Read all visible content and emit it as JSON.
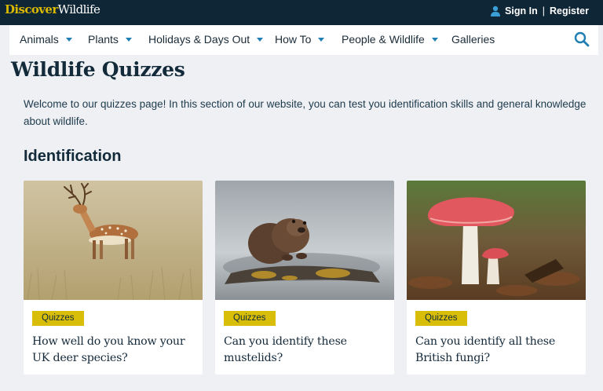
{
  "header": {
    "logo_part1": "Discover",
    "logo_part2": "Wildlife",
    "sign_in": "Sign In",
    "separator": "|",
    "register": "Register"
  },
  "nav": {
    "items": [
      {
        "label": "Animals",
        "has_dropdown": true
      },
      {
        "label": "Plants",
        "has_dropdown": true
      },
      {
        "label": "Holidays & Days Out",
        "has_dropdown": true
      },
      {
        "label": "How To",
        "has_dropdown": true
      },
      {
        "label": "People & Wildlife",
        "has_dropdown": true
      },
      {
        "label": "Galleries",
        "has_dropdown": false
      }
    ],
    "search_icon": "search-icon"
  },
  "main": {
    "title": "Wildlife Quizzes",
    "intro": "Welcome to our quizzes page! In this section of our website, you can test you identification skills and general knowledge about wildlife.",
    "section_heading": "Identification",
    "cards": [
      {
        "badge": "Quizzes",
        "title": "How well do you know your UK deer species?",
        "image": "fallow-deer-photo"
      },
      {
        "badge": "Quizzes",
        "title": "Can you identify these mustelids?",
        "image": "otter-photo"
      },
      {
        "badge": "Quizzes",
        "title": "Can you identify all these British fungi?",
        "image": "red-mushroom-photo"
      }
    ]
  },
  "colors": {
    "topbar": "#0f2636",
    "logo_accent": "#d9b800",
    "accent_blue": "#1f7fb3",
    "badge": "#d8bd09",
    "page_bg": "#eef0f3"
  }
}
